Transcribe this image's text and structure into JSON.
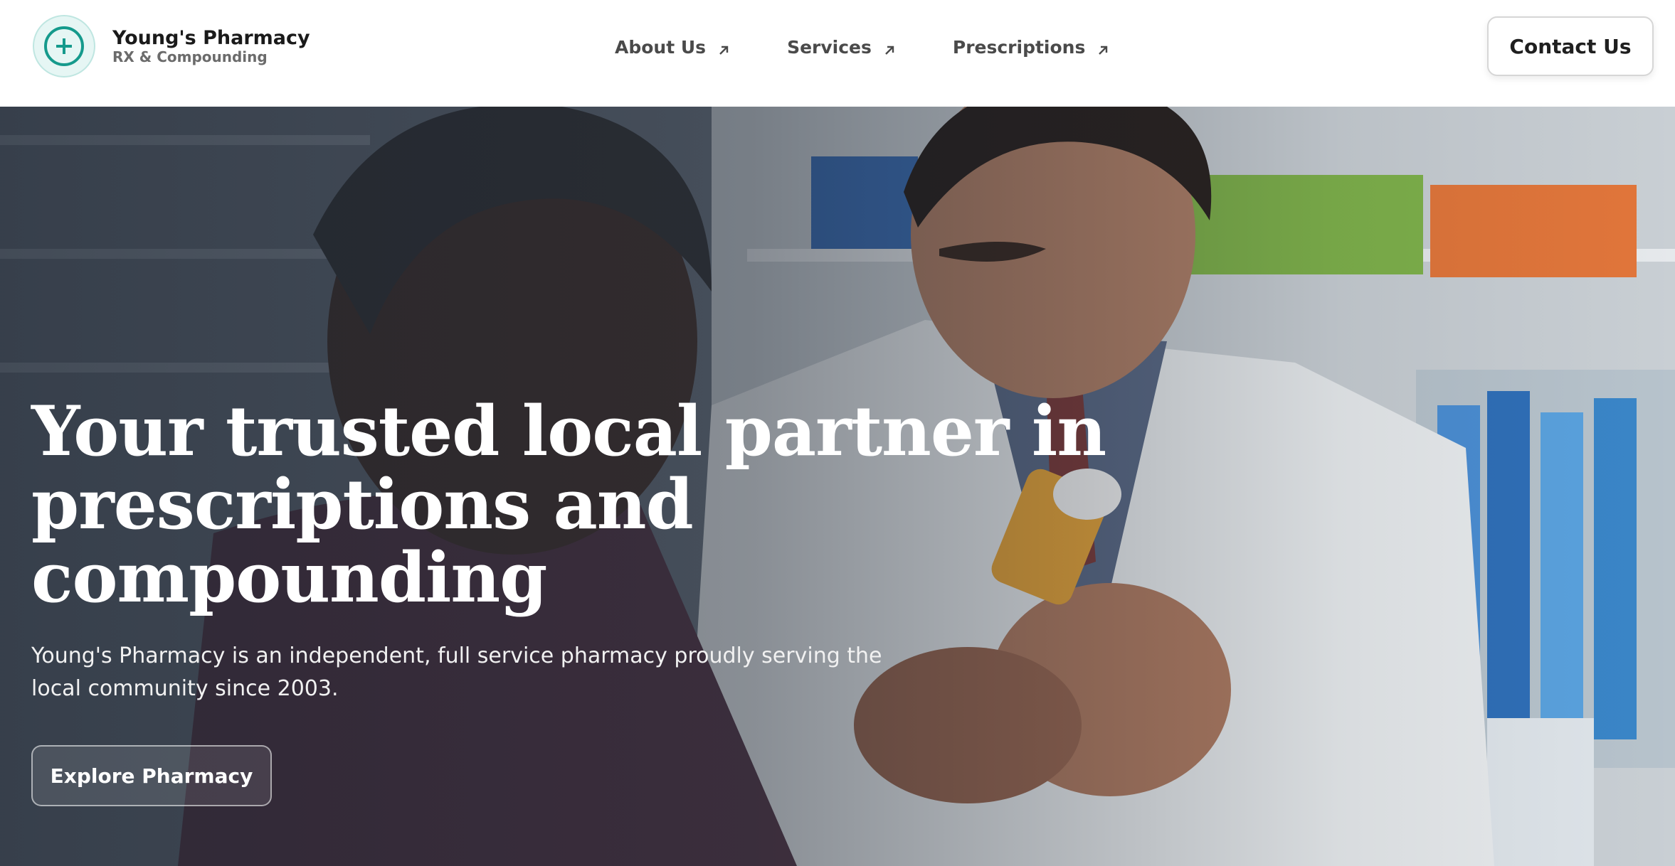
{
  "brand": {
    "name": "Young's Pharmacy",
    "tagline": "RX & Compounding",
    "logo_icon": "plus-icon",
    "accent_color": "#159a8c"
  },
  "nav": {
    "items": [
      {
        "label": "About Us",
        "icon": "arrow-up-right-icon"
      },
      {
        "label": "Services",
        "icon": "arrow-up-right-icon"
      },
      {
        "label": "Prescriptions",
        "icon": "arrow-up-right-icon"
      }
    ],
    "contact_label": "Contact Us"
  },
  "hero": {
    "title": "Your trusted local partner in prescriptions and compounding",
    "description": "Young's Pharmacy is an independent, full service pharmacy proudly serving the local community since 2003.",
    "cta_label": "Explore Pharmacy",
    "image_subject": "pharmacist-showing-prescription-bottle-to-customer"
  }
}
